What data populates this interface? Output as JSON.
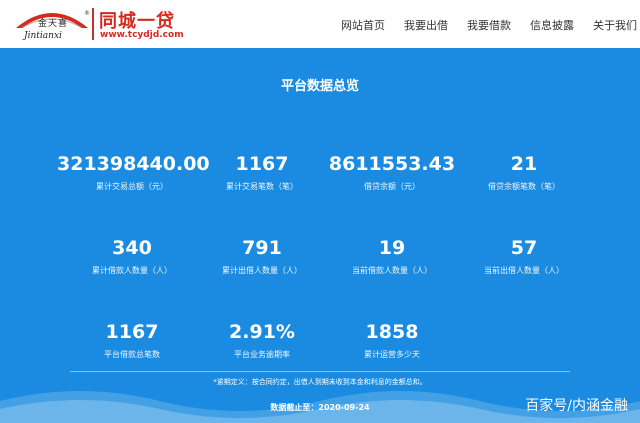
{
  "header": {
    "logo": {
      "cn_text": "金天喜",
      "en_text": "Jintianxi",
      "reg_mark": "®",
      "brand": "同城一贷",
      "url": "www.tcydjd.com"
    },
    "nav": [
      {
        "label": "网站首页"
      },
      {
        "label": "我要出借"
      },
      {
        "label": "我要借款"
      },
      {
        "label": "信息披露"
      },
      {
        "label": "关于我们"
      }
    ]
  },
  "overview": {
    "title": "平台数据总览",
    "stats": [
      {
        "value": "321398440.00",
        "label": "累计交易总额（元）"
      },
      {
        "value": "1167",
        "label": "累计交易笔数（笔）"
      },
      {
        "value": "8611553.43",
        "label": "借贷余额（元）"
      },
      {
        "value": "21",
        "label": "借贷余额笔数（笔）"
      },
      {
        "value": "340",
        "label": "累计借款人数量（人）"
      },
      {
        "value": "791",
        "label": "累计出借人数量（人）"
      },
      {
        "value": "19",
        "label": "当前借款人数量（人）"
      },
      {
        "value": "57",
        "label": "当前出借人数量（人）"
      },
      {
        "value": "1167",
        "label": "平台借款总笔数"
      },
      {
        "value": "2.91%",
        "label": "平台业务逾期率"
      },
      {
        "value": "1858",
        "label": "累计运营多少天"
      }
    ],
    "note": "*逾期定义：按合同约定，出借人到期未收到本金和利息的金额总和。",
    "as_of_label": "数据截止至：",
    "as_of_date": "2020-09-24"
  },
  "watermark": "百家号/内涵金融",
  "colors": {
    "background": "#1a8be0",
    "brand_red": "#d52b1e",
    "text": "#ffffff"
  }
}
